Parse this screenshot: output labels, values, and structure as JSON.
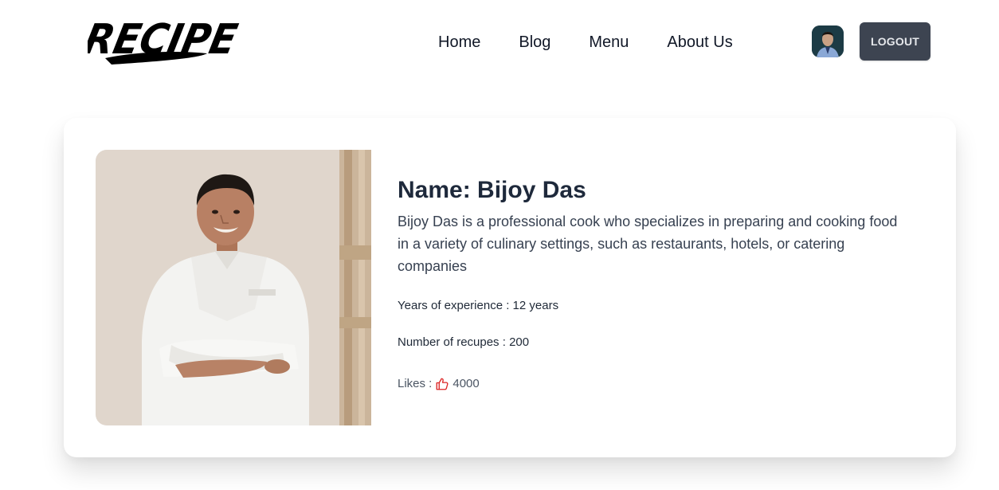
{
  "header": {
    "logo_text": "RECIPE",
    "nav": [
      {
        "label": "Home"
      },
      {
        "label": "Blog"
      },
      {
        "label": "Menu"
      },
      {
        "label": "About Us"
      }
    ],
    "logout_label": "LOGOUT"
  },
  "profile": {
    "name_prefix": "Name: ",
    "name": "Bijoy Das",
    "description": "Bijoy Das is a professional cook who specializes in preparing and cooking food in a variety of culinary settings, such as restaurants, hotels, or catering companies",
    "experience_label": "Years of experience : ",
    "experience_value": "12 years",
    "recipes_label": "Number of recupes : ",
    "recipes_value": "200",
    "likes_label": "Likes :",
    "likes_value": "4000",
    "likes_icon": "thumbs-up-icon"
  },
  "colors": {
    "logout_bg": "#3d4451",
    "heading": "#1e293b",
    "thumb": "#dc2626"
  }
}
